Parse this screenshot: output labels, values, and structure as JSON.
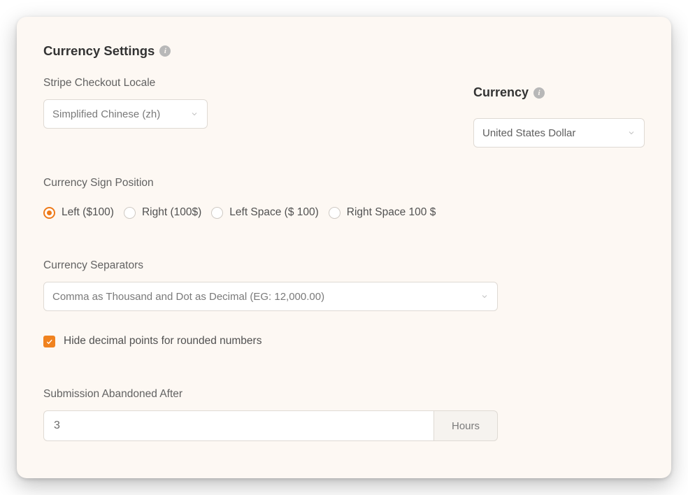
{
  "header": {
    "title": "Currency Settings"
  },
  "locale": {
    "label": "Stripe Checkout Locale",
    "selected": "Simplified Chinese (zh)"
  },
  "currency": {
    "title": "Currency",
    "selected": "United States Dollar"
  },
  "sign_position": {
    "label": "Currency Sign Position",
    "options": [
      {
        "label": "Left ($100)",
        "checked": true
      },
      {
        "label": "Right (100$)",
        "checked": false
      },
      {
        "label": "Left Space ($ 100)",
        "checked": false
      },
      {
        "label": "Right Space 100 $",
        "checked": false
      }
    ]
  },
  "separators": {
    "label": "Currency Separators",
    "selected": "Comma as Thousand and Dot as Decimal (EG: 12,000.00)"
  },
  "hide_decimals": {
    "label": "Hide decimal points for rounded numbers",
    "checked": true
  },
  "abandoned": {
    "label": "Submission Abandoned After",
    "value": "3",
    "unit": "Hours"
  }
}
